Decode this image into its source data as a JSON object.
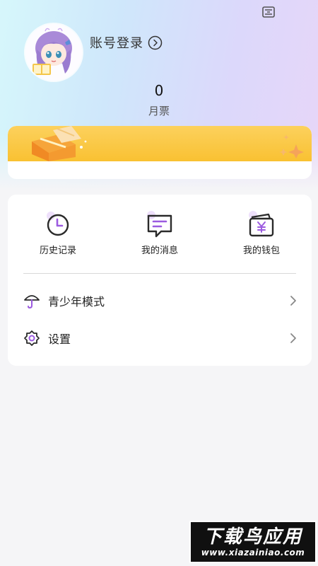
{
  "profile": {
    "login_label": "账号登录",
    "ticket_count": "0",
    "ticket_label": "月票"
  },
  "quick_actions": [
    {
      "label": "历史记录",
      "icon": "history-clock-icon"
    },
    {
      "label": "我的消息",
      "icon": "message-icon"
    },
    {
      "label": "我的钱包",
      "icon": "wallet-icon"
    }
  ],
  "menu": [
    {
      "label": "青少年模式",
      "icon": "umbrella-icon"
    },
    {
      "label": "设置",
      "icon": "settings-gear-icon"
    }
  ],
  "watermark": {
    "title": "下载鸟应用",
    "url": "www.xiazainiao.com"
  },
  "colors": {
    "accent": "#9c5be0",
    "banner": "#f9c132"
  }
}
